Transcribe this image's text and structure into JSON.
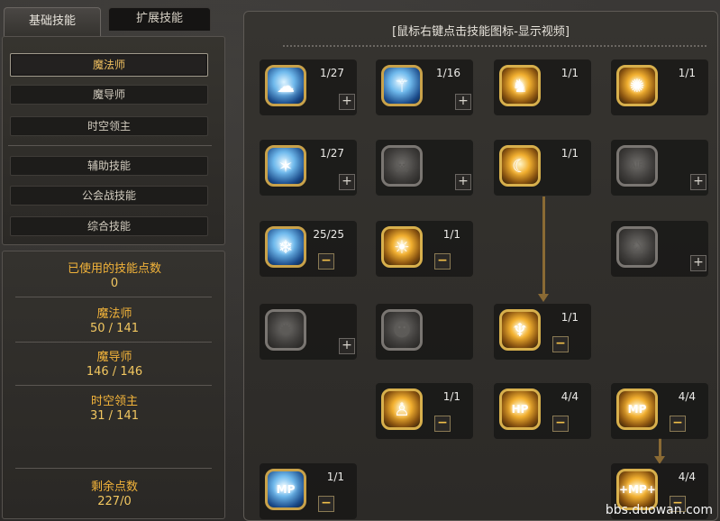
{
  "tabs": {
    "basic": "基础技能",
    "extended": "扩展技能"
  },
  "categories": [
    {
      "label": "魔法师",
      "active": true
    },
    {
      "label": "魔导师",
      "active": false
    },
    {
      "label": "时空领主",
      "active": false
    },
    {
      "label": "辅助技能",
      "active": false
    },
    {
      "label": "公会战技能",
      "active": false
    },
    {
      "label": "综合技能",
      "active": false
    }
  ],
  "stats": {
    "used_label": "已使用的技能点数",
    "used_value": "0",
    "class1_label": "魔法师",
    "class1_value": "50 / 141",
    "class2_label": "魔导师",
    "class2_value": "146 / 146",
    "class3_label": "时空领主",
    "class3_value": "31 / 141",
    "remain_label": "剩余点数",
    "remain_value": "227/0"
  },
  "header_hint": "[鼠标右键点击技能图标-显示视频]",
  "skills": [
    {
      "id": "s1",
      "level": "1/27",
      "button": "+",
      "style": "blue",
      "icon": "cloud-wave-icon"
    },
    {
      "id": "s2",
      "level": "1/16",
      "button": "+",
      "style": "blue",
      "icon": "staff-orb-icon"
    },
    {
      "id": "s3",
      "level": "1/1",
      "button": "",
      "style": "gold",
      "icon": "boot-kick-icon"
    },
    {
      "id": "s4",
      "level": "1/1",
      "button": "",
      "style": "gold",
      "icon": "spark-burst-icon"
    },
    {
      "id": "s5",
      "level": "1/27",
      "button": "+",
      "style": "blue",
      "icon": "star-shatter-icon"
    },
    {
      "id": "s6",
      "level": "",
      "button": "+",
      "style": "gray",
      "icon": "skull-icon"
    },
    {
      "id": "s7",
      "level": "1/1",
      "button": "",
      "style": "gold",
      "icon": "crescent-slash-icon"
    },
    {
      "id": "s8",
      "level": "",
      "button": "+",
      "style": "gray",
      "icon": "air-icon"
    },
    {
      "id": "s9",
      "level": "25/25",
      "button": "−",
      "style": "blue",
      "icon": "ice-burst-icon"
    },
    {
      "id": "s10",
      "level": "1/1",
      "button": "−",
      "style": "gold",
      "icon": "radiant-figure-icon"
    },
    {
      "id": "s11",
      "level": "",
      "button": "+",
      "style": "gray",
      "icon": "dragon-head-icon"
    },
    {
      "id": "s12",
      "level": "",
      "button": "+",
      "style": "gray",
      "icon": "dark-vortex-icon"
    },
    {
      "id": "s13",
      "level": "",
      "button": "",
      "style": "gray",
      "icon": "stone-face-icon"
    },
    {
      "id": "s14",
      "level": "1/1",
      "button": "−",
      "style": "gold",
      "icon": "figure-arms-up-icon"
    },
    {
      "id": "s15",
      "level": "1/1",
      "button": "−",
      "style": "gold",
      "icon": "leaping-figure-icon"
    },
    {
      "id": "s16",
      "level": "4/4",
      "button": "−",
      "style": "gold",
      "icon": "hp-boost-icon",
      "text": "HP"
    },
    {
      "id": "s17",
      "level": "4/4",
      "button": "−",
      "style": "gold",
      "icon": "mp-boost-icon",
      "text": "MP"
    },
    {
      "id": "s18",
      "level": "1/1",
      "button": "−",
      "style": "blue",
      "icon": "mp-down-icon",
      "text": "MP"
    },
    {
      "id": "s19",
      "level": "4/4",
      "button": "−",
      "style": "gold",
      "icon": "mp-plus-icon",
      "text": "+MP+"
    }
  ],
  "watermark": "bbs.duowan.com",
  "colors": {
    "accent": "#f2b33a",
    "gold_frame": "#d8b04c",
    "connector": "#8a6a34"
  }
}
